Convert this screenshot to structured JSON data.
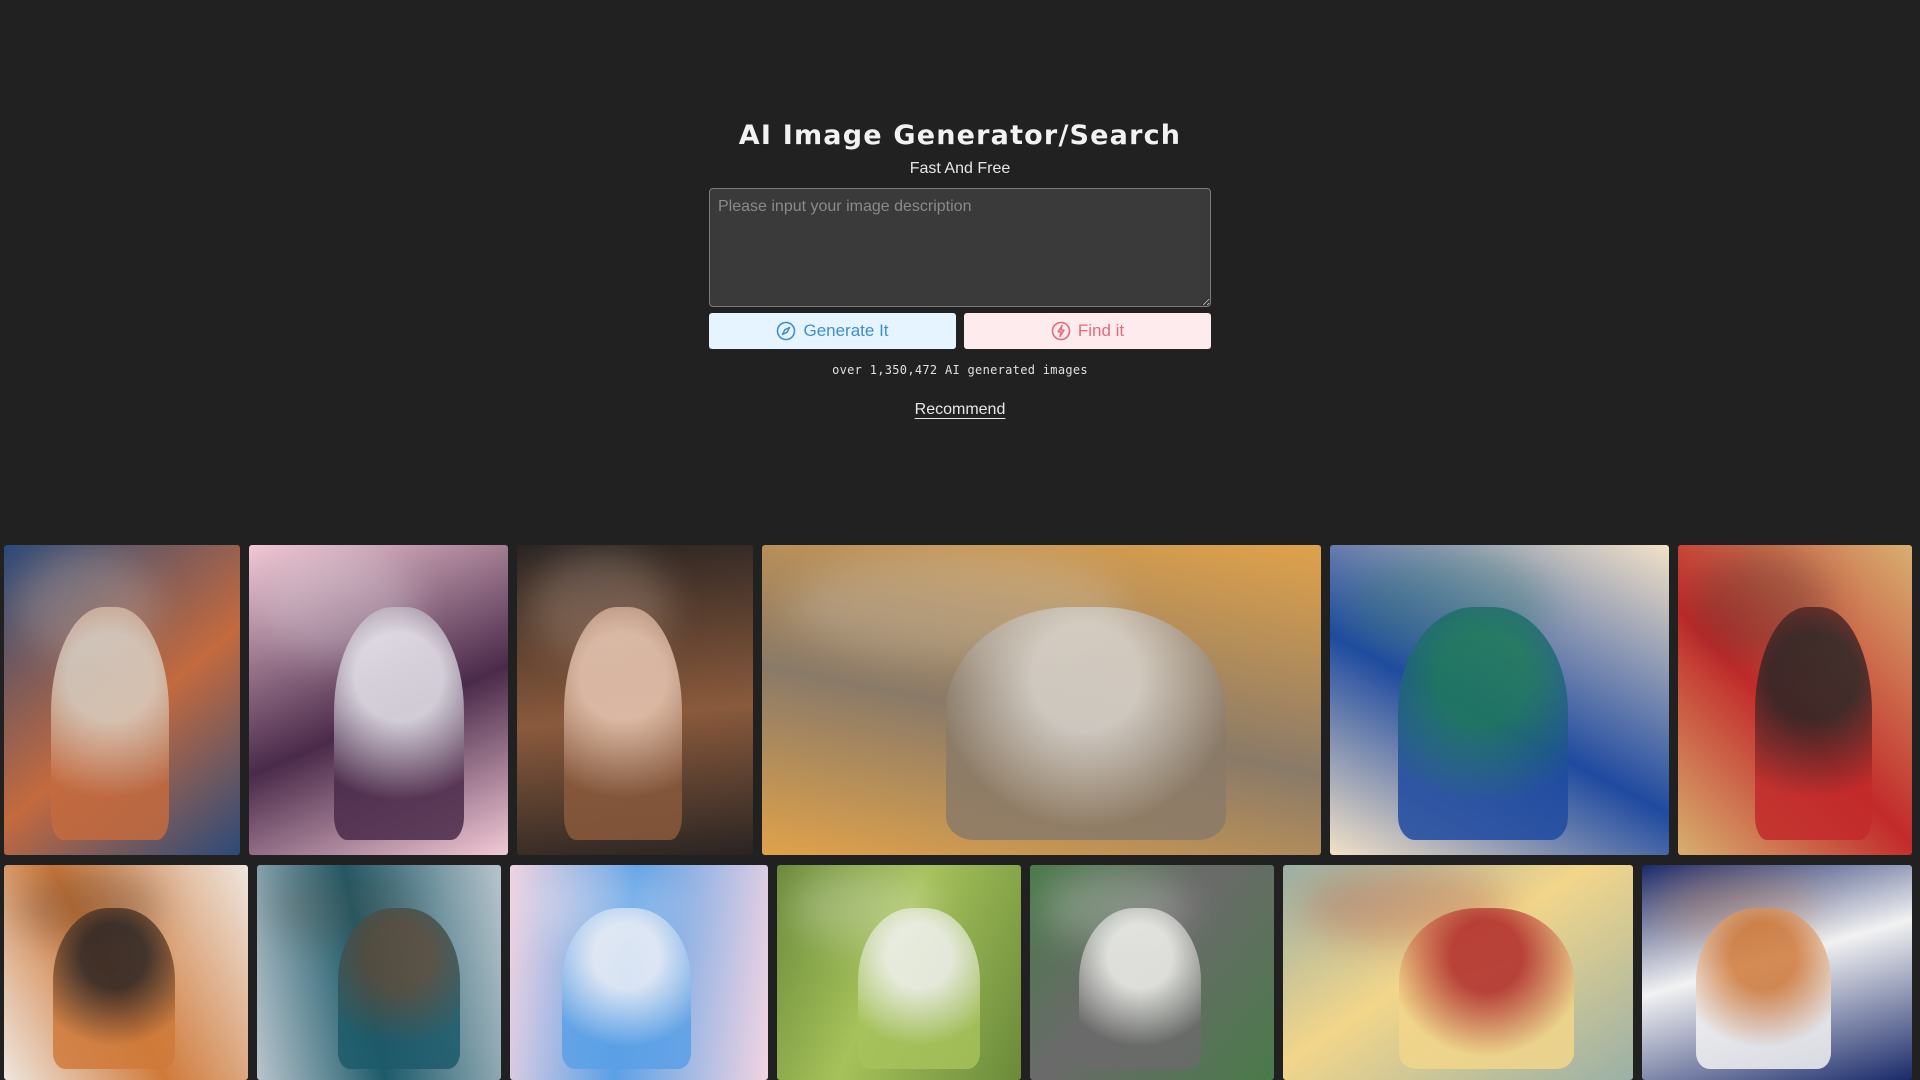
{
  "header": {
    "title": "AI Image Generator/Search",
    "subtitle": "Fast And Free"
  },
  "prompt": {
    "placeholder": "Please input your image description",
    "value": ""
  },
  "actions": {
    "generate_label": "Generate It",
    "find_label": "Find it"
  },
  "stats": {
    "text": "over 1,350,472 AI generated images"
  },
  "nav": {
    "recommend_label": "Recommend"
  },
  "colors": {
    "background": "#212121",
    "generate_bg": "#e6f4ff",
    "generate_fg": "#3d8fd0",
    "find_bg": "#fdebee",
    "find_fg": "#e46b7a"
  },
  "icons": {
    "generate": "compass-icon",
    "find": "lightning-icon"
  },
  "gallery": {
    "images": [
      {
        "name": "anime-girl-street-night-sky",
        "palette": [
          "#2b4a7a",
          "#c46a3e",
          "#d9d0c4"
        ]
      },
      {
        "name": "anime-girl-cherry-blossom-purple-hair",
        "palette": [
          "#f2c9d6",
          "#4a2a4a",
          "#e8e8ee"
        ]
      },
      {
        "name": "anime-girl-portrait-brown-hair",
        "palette": [
          "#2a2422",
          "#8a5a3c",
          "#e9c8b4"
        ]
      },
      {
        "name": "anime-girl-autumn-kimono",
        "palette": [
          "#e0a24a",
          "#8a7a68",
          "#d8d4ce"
        ]
      },
      {
        "name": "peacock-floral-painting",
        "palette": [
          "#f3e2c6",
          "#1f4aa0",
          "#1f7a5a"
        ]
      },
      {
        "name": "anime-girl-grocery-store",
        "palette": [
          "#d8b070",
          "#c22a2a",
          "#2a2626"
        ]
      },
      {
        "name": "anime-girl-orange-hair-jacket",
        "palette": [
          "#eee6de",
          "#d07a3a",
          "#2a2424"
        ]
      },
      {
        "name": "woman-teal-hair-crop-top",
        "palette": [
          "#b8c4cc",
          "#1c5a6a",
          "#5a4a3a"
        ]
      },
      {
        "name": "anime-girl-blue-hair-sailor",
        "palette": [
          "#f2d4e2",
          "#5aa0e6",
          "#eef0f6"
        ]
      },
      {
        "name": "anime-bunny-girl-forest",
        "palette": [
          "#6a8a3a",
          "#a6c25a",
          "#f2f2f2"
        ]
      },
      {
        "name": "anime-boy-totoro-sunglasses",
        "palette": [
          "#4a7a4a",
          "#6a6a6a",
          "#f2f2ee"
        ]
      },
      {
        "name": "butter-bunny-sculpture",
        "palette": [
          "#9ab0a6",
          "#f2d68a",
          "#b02a2a"
        ]
      },
      {
        "name": "owl-chibi-girl-bokeh",
        "palette": [
          "#1a2a6a",
          "#f2f2f2",
          "#d07a3a"
        ]
      }
    ]
  }
}
